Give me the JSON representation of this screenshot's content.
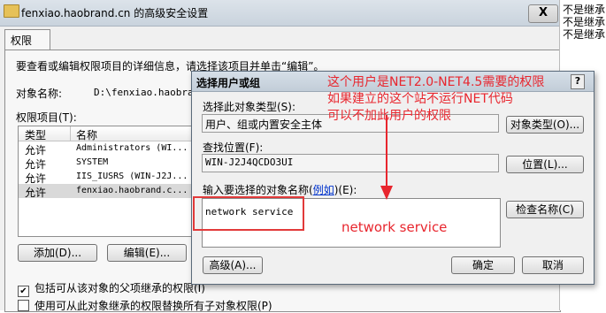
{
  "back_window": {
    "title": "fenxiao.haobrand.cn 的高级安全设置",
    "close_label": "X",
    "tab": "权限",
    "instruction": "要查看或编辑权限项目的详细信息，请选择该项目并单击“编辑”。",
    "object_name_label": "对象名称:",
    "object_name_value": "D:\\fenxiao.haobrand.co",
    "perm_items_label": "权限项目(T):",
    "columns": {
      "type": "类型",
      "name": "名称"
    },
    "rows": [
      {
        "type": "允许",
        "name": "Administrators (WI..."
      },
      {
        "type": "允许",
        "name": "SYSTEM"
      },
      {
        "type": "允许",
        "name": "IIS_IUSRS (WIN-J2J..."
      },
      {
        "type": "允许",
        "name": "fenxiao.haobrand.c..."
      }
    ],
    "add_button": "添加(D)...",
    "edit_button": "编辑(E)...",
    "inherit_checkbox": "包括可从该对象的父项继承的权限(I)",
    "replace_checkbox": "使用可从此对象继承的权限替换所有子对象权限(P)",
    "inherit_checked": true,
    "replace_checked": false
  },
  "edge_items": [
    "不是继承",
    "不是继承",
    "不是继承"
  ],
  "dialog": {
    "title": "选择用户或组",
    "help": "?",
    "object_type_label": "选择此对象类型(S):",
    "object_type_value": "用户、组或内置安全主体",
    "object_type_button": "对象类型(O)...",
    "location_label": "查找位置(F):",
    "location_value": "WIN-J2J4QCDO3UI",
    "location_button": "位置(L)...",
    "names_label_prefix": "输入要选择的对象名称(",
    "names_label_link": "例如",
    "names_label_suffix": ")(E):",
    "names_value": "network service",
    "check_names_button": "检查名称(C)",
    "advanced_button": "高级(A)...",
    "ok_button": "确定",
    "cancel_button": "取消"
  },
  "annotations": {
    "line1": "这个用户是NET2.0-NET4.5需要的权限",
    "line2": "如果建立的这个站不运行NET代码",
    "line3": "可以不加此用户的权限",
    "net_label": "network service",
    "color": "#e8262e"
  }
}
